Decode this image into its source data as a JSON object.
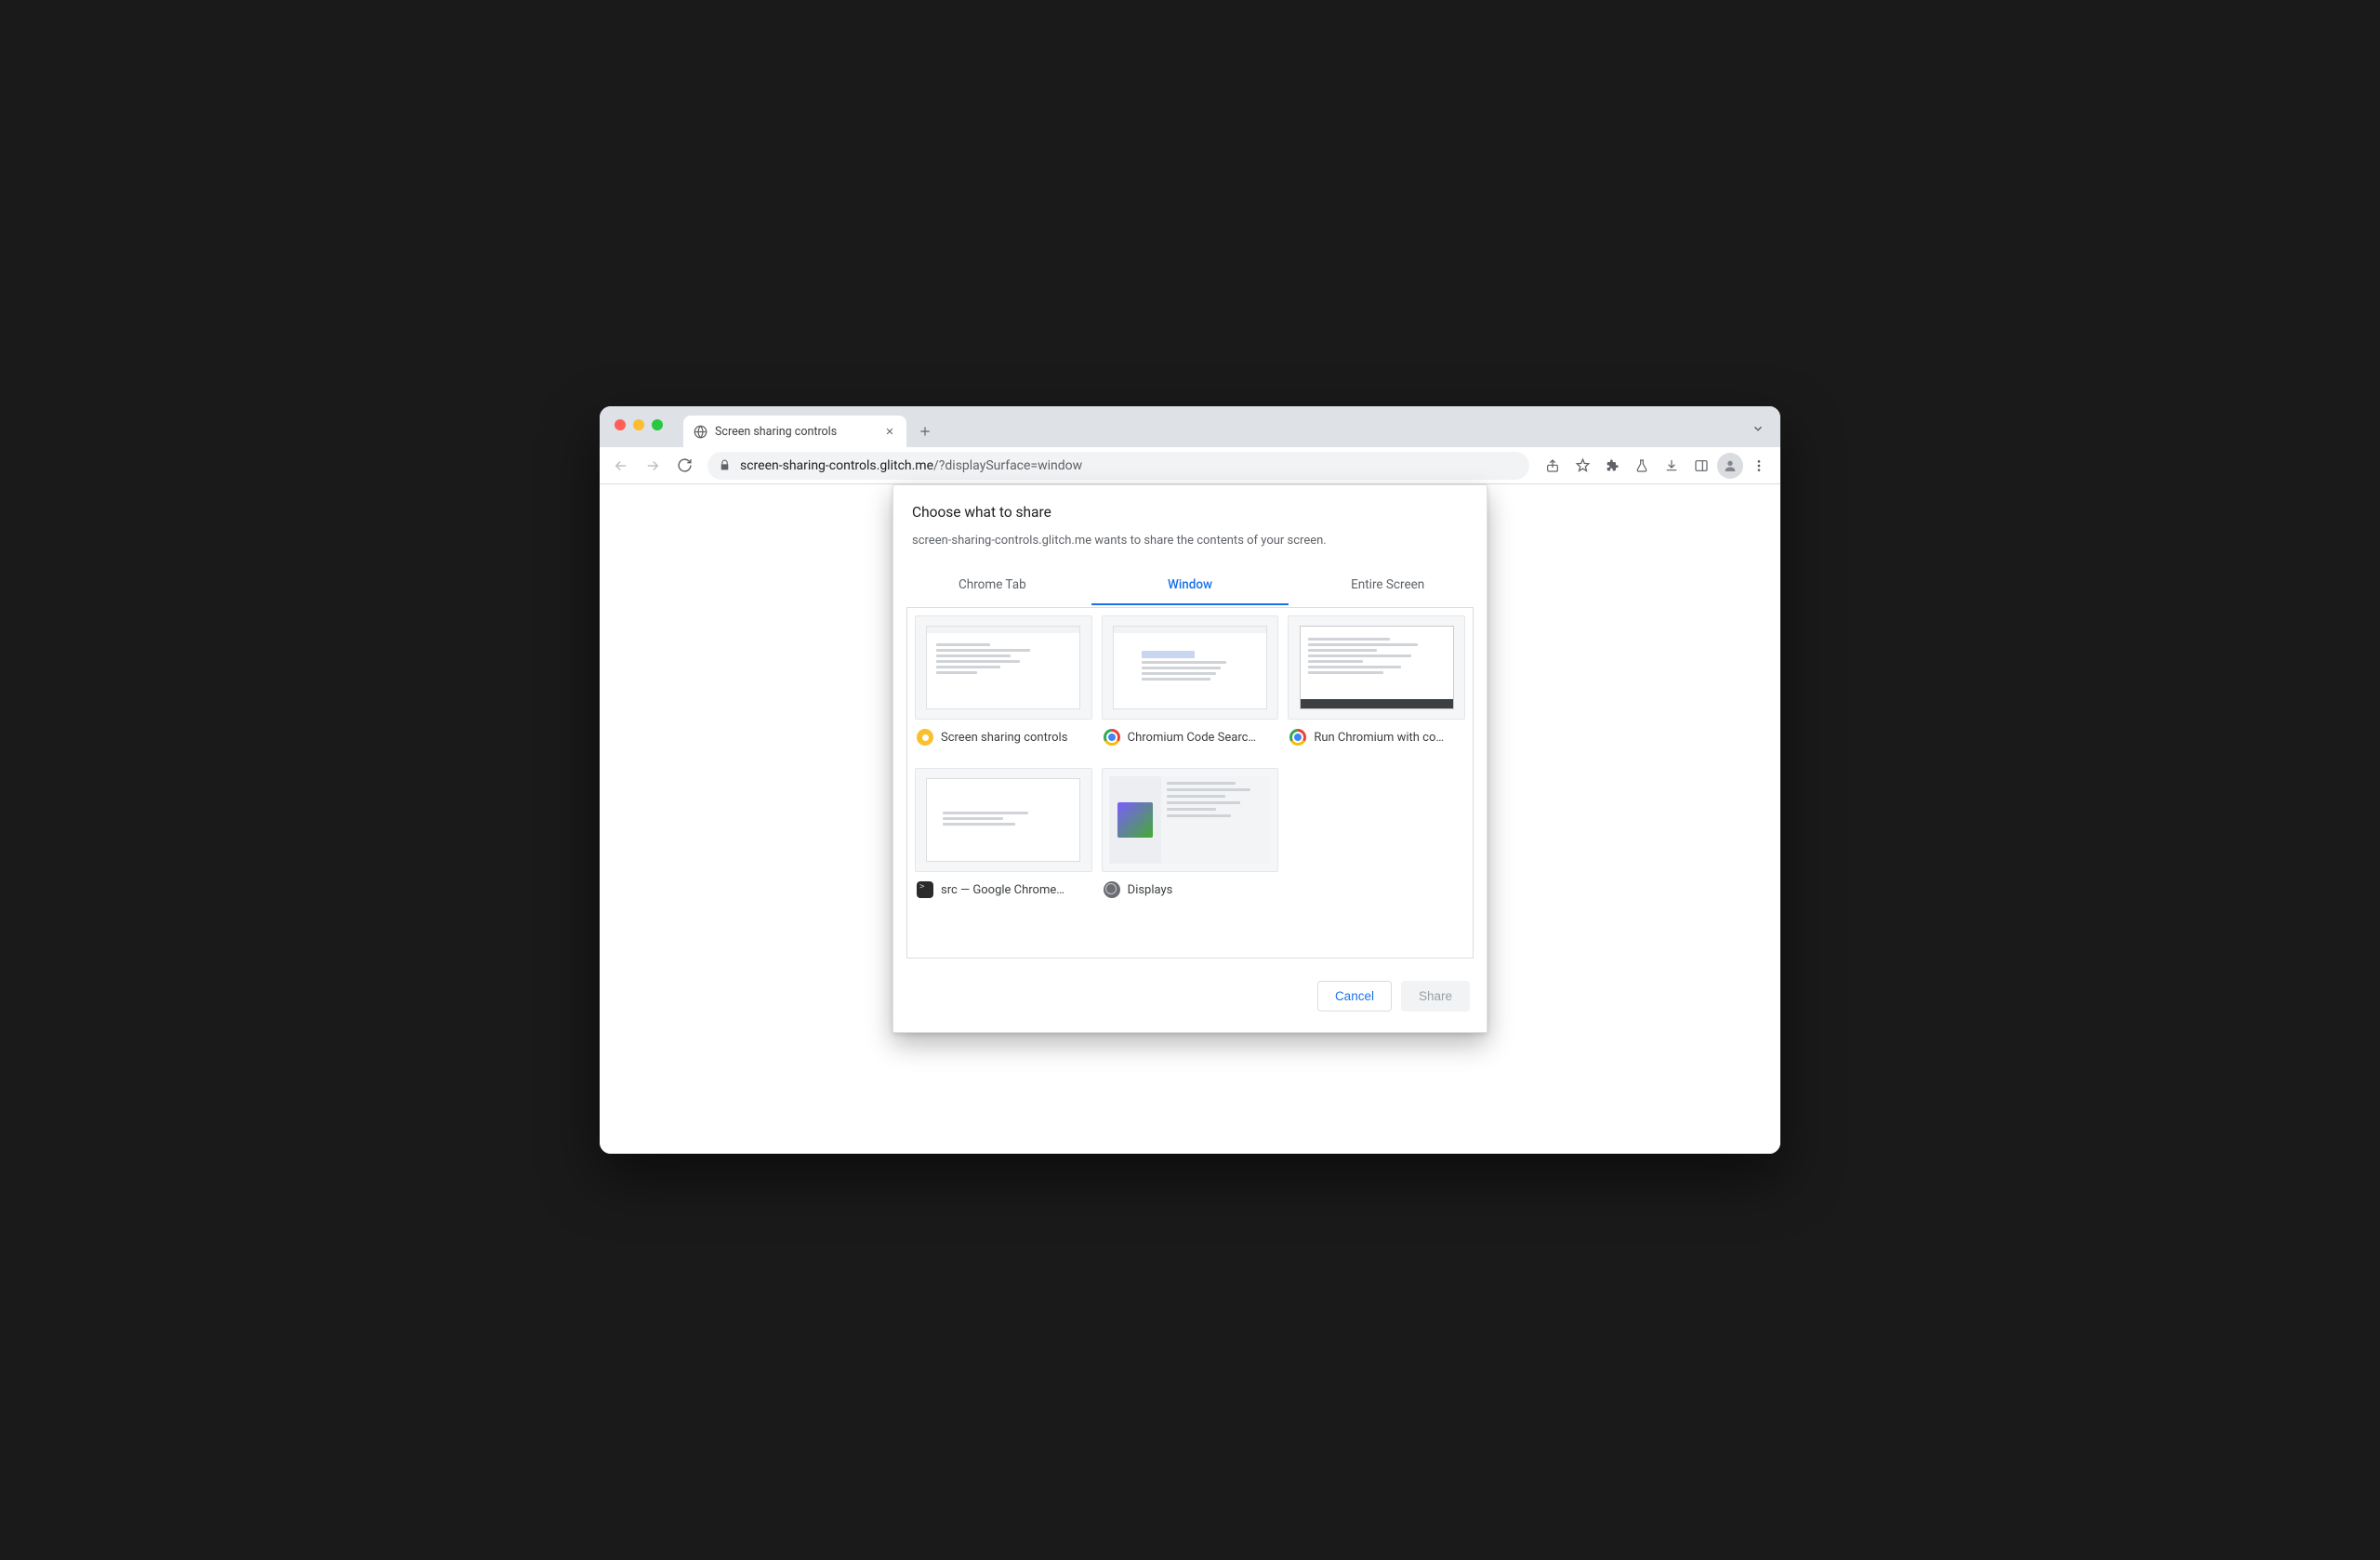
{
  "browser": {
    "tab_title": "Screen sharing controls",
    "url_host": "screen-sharing-controls.glitch.me",
    "url_path": "/?displaySurface=window"
  },
  "modal": {
    "title": "Choose what to share",
    "subtitle": "screen-sharing-controls.glitch.me wants to share the contents of your screen.",
    "tabs": {
      "chrome_tab": "Chrome Tab",
      "window": "Window",
      "entire_screen": "Entire Screen"
    },
    "active_tab": "window",
    "windows": [
      {
        "label": "Screen sharing controls",
        "app": "canary"
      },
      {
        "label": "Chromium Code Searc…",
        "app": "chrome"
      },
      {
        "label": "Run Chromium with co…",
        "app": "chrome"
      },
      {
        "label": "src — Google Chrome…",
        "app": "term"
      },
      {
        "label": "Displays",
        "app": "sys"
      }
    ],
    "buttons": {
      "cancel": "Cancel",
      "share": "Share"
    }
  }
}
